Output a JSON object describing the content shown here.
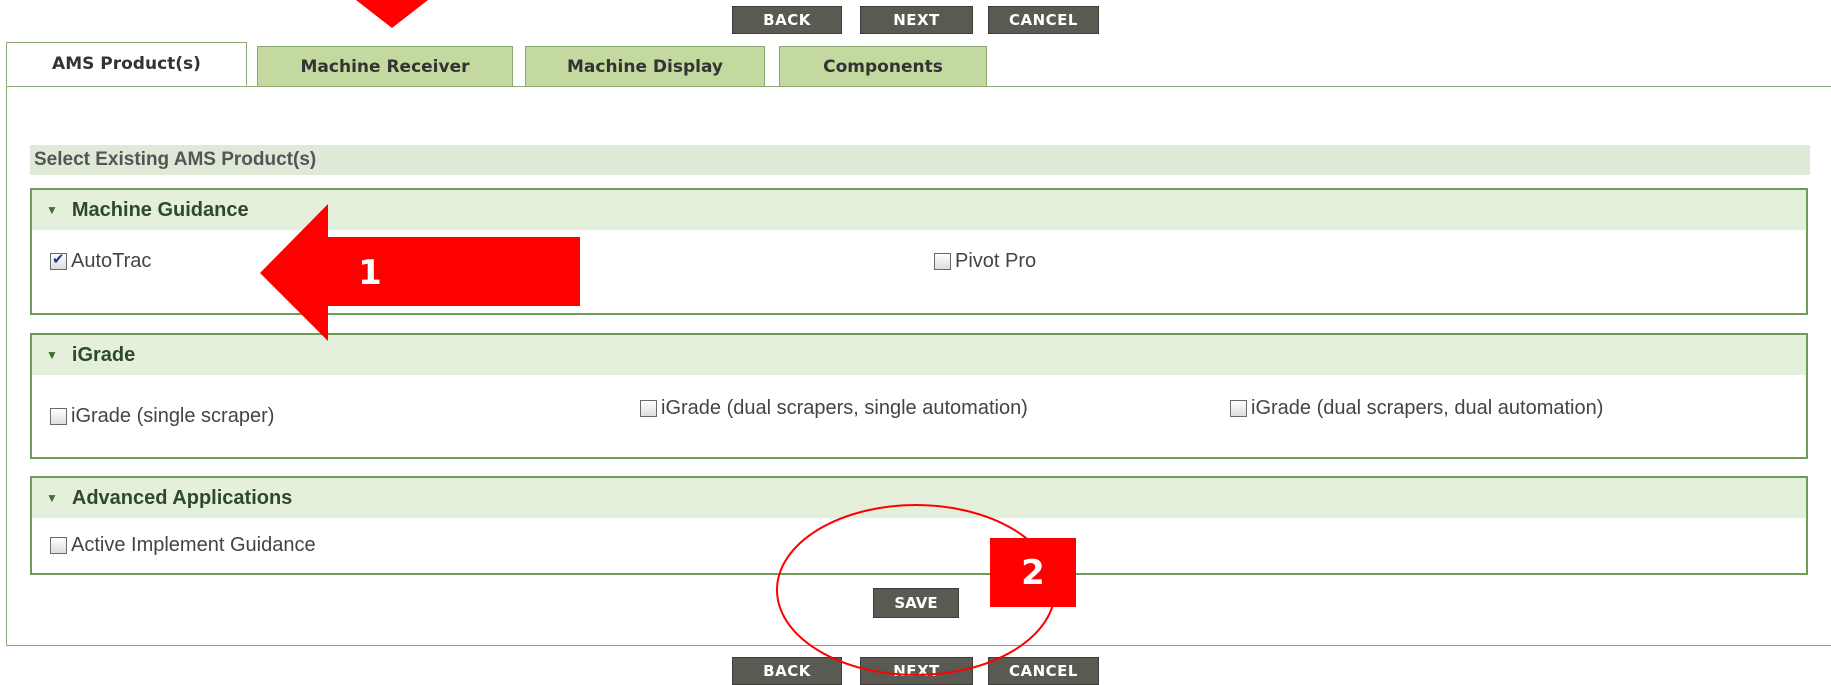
{
  "nav": {
    "back": "BACK",
    "next": "NEXT",
    "cancel": "CANCEL"
  },
  "tabs": [
    {
      "label": "AMS Product(s)",
      "active": true
    },
    {
      "label": "Machine Receiver",
      "active": false
    },
    {
      "label": "Machine Display",
      "active": false
    },
    {
      "label": "Components",
      "active": false
    }
  ],
  "section_title": "Select Existing AMS Product(s)",
  "groups": [
    {
      "title": "Machine Guidance",
      "options": [
        {
          "label": "AutoTrac",
          "checked": true
        },
        {
          "label": "Pivot Pro",
          "checked": false
        }
      ]
    },
    {
      "title": "iGrade",
      "options": [
        {
          "label": "iGrade (single scraper)",
          "checked": false
        },
        {
          "label": "iGrade (dual scrapers, single automation)",
          "checked": false
        },
        {
          "label": "iGrade (dual scrapers, dual automation)",
          "checked": false
        }
      ]
    },
    {
      "title": "Advanced Applications",
      "options": [
        {
          "label": "Active Implement Guidance",
          "checked": false
        }
      ]
    }
  ],
  "save_label": "SAVE",
  "annotations": {
    "label_1": "1",
    "label_2": "2",
    "color": "#ff0000"
  }
}
